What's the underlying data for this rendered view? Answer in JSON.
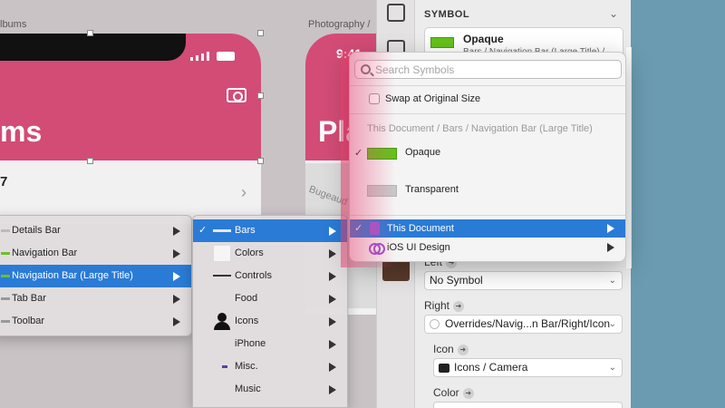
{
  "canvas": {
    "artboard_labels": [
      "lbums",
      "Photography /"
    ],
    "artboard1": {
      "title": "ms",
      "row_text": "7"
    },
    "artboard2": {
      "title": "Pla",
      "time": "9:41"
    },
    "map_text": "Bugeaud"
  },
  "inspector": {
    "section_title": "SYMBOL",
    "symbol_name": "Opaque",
    "symbol_path": "Bars / Navigation Bar (Large Title) /",
    "left_label": "Left",
    "left_value": "No Symbol",
    "right_label": "Right",
    "right_value": "Overrides/Navig...n Bar/Right/Icon",
    "icon_label": "Icon",
    "icon_value": "Icons / Camera",
    "color_label": "Color"
  },
  "menu1": {
    "items": [
      {
        "label": "Details Bar"
      },
      {
        "label": "Navigation Bar"
      },
      {
        "label": "Navigation Bar (Large Title)"
      },
      {
        "label": "Tab Bar"
      },
      {
        "label": "Toolbar"
      }
    ]
  },
  "menu2": {
    "items": [
      {
        "label": "Bars"
      },
      {
        "label": "Colors"
      },
      {
        "label": "Controls"
      },
      {
        "label": "Food"
      },
      {
        "label": "Icons"
      },
      {
        "label": "iPhone"
      },
      {
        "label": "Misc."
      },
      {
        "label": "Music"
      }
    ]
  },
  "popover": {
    "search_placeholder": "Search Symbols",
    "swap_label": "Swap at Original Size",
    "group_header": "This Document / Bars / Navigation Bar (Large Title)",
    "symbols": [
      {
        "label": "Opaque",
        "checked": "✓"
      },
      {
        "label": "Transparent"
      }
    ],
    "libraries": [
      {
        "label": "This Document",
        "checked": "✓"
      },
      {
        "label": "iOS UI Design"
      }
    ]
  },
  "colors": {
    "accent": "#2a7bd6",
    "nav_pink": "#d24c76",
    "symbol_green": "#64c21a"
  }
}
